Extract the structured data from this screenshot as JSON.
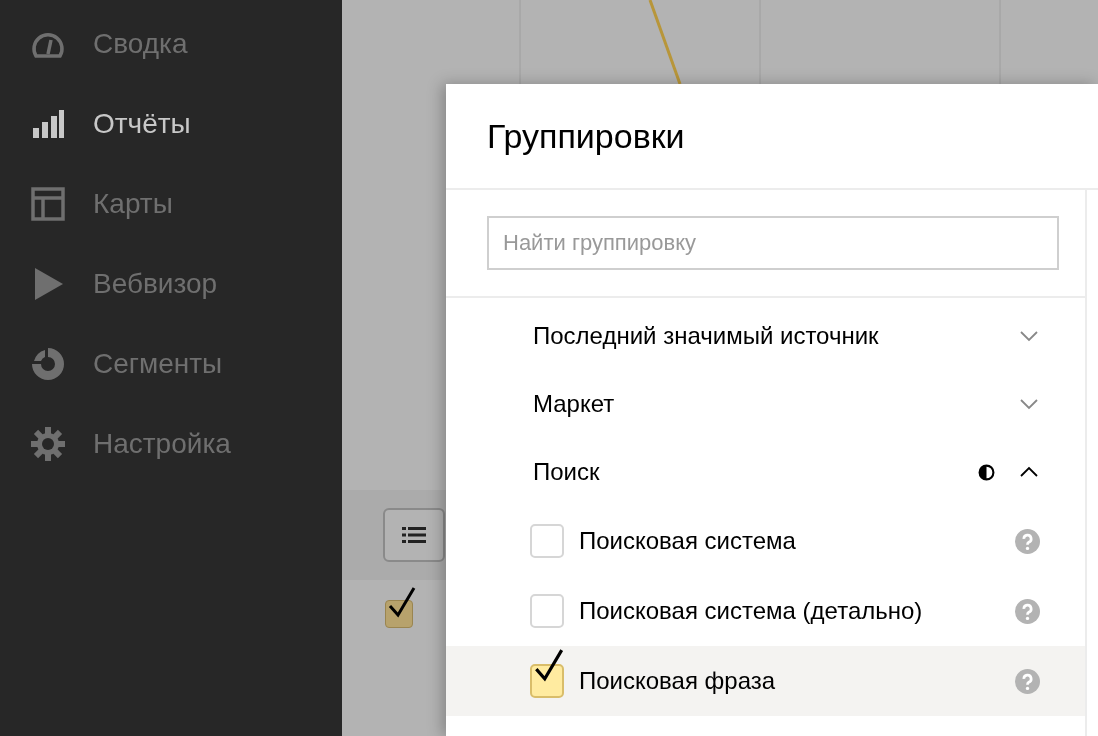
{
  "sidebar": {
    "items": [
      {
        "label": "Сводка",
        "kind": "gauge",
        "selected": false
      },
      {
        "label": "Отчёты",
        "kind": "bars",
        "selected": true
      },
      {
        "label": "Карты",
        "kind": "layout",
        "selected": false
      },
      {
        "label": "Вебвизор",
        "kind": "play",
        "selected": false
      },
      {
        "label": "Сегменты",
        "kind": "ring",
        "selected": false
      },
      {
        "label": "Настройка",
        "kind": "gear",
        "selected": false
      }
    ]
  },
  "background": {
    "row_checked": true
  },
  "dialog": {
    "title": "Группировки",
    "search": {
      "placeholder": "Найти группировку"
    },
    "groups": [
      {
        "label": "Последний значимый источник",
        "expanded": false,
        "partial": false
      },
      {
        "label": "Маркет",
        "expanded": false,
        "partial": false
      },
      {
        "label": "Поиск",
        "expanded": true,
        "partial": true,
        "children": [
          {
            "label": "Поисковая система",
            "checked": false,
            "selected": false
          },
          {
            "label": "Поисковая система (детально)",
            "checked": false,
            "selected": false
          },
          {
            "label": "Поисковая фраза",
            "checked": true,
            "selected": true
          }
        ]
      }
    ]
  }
}
